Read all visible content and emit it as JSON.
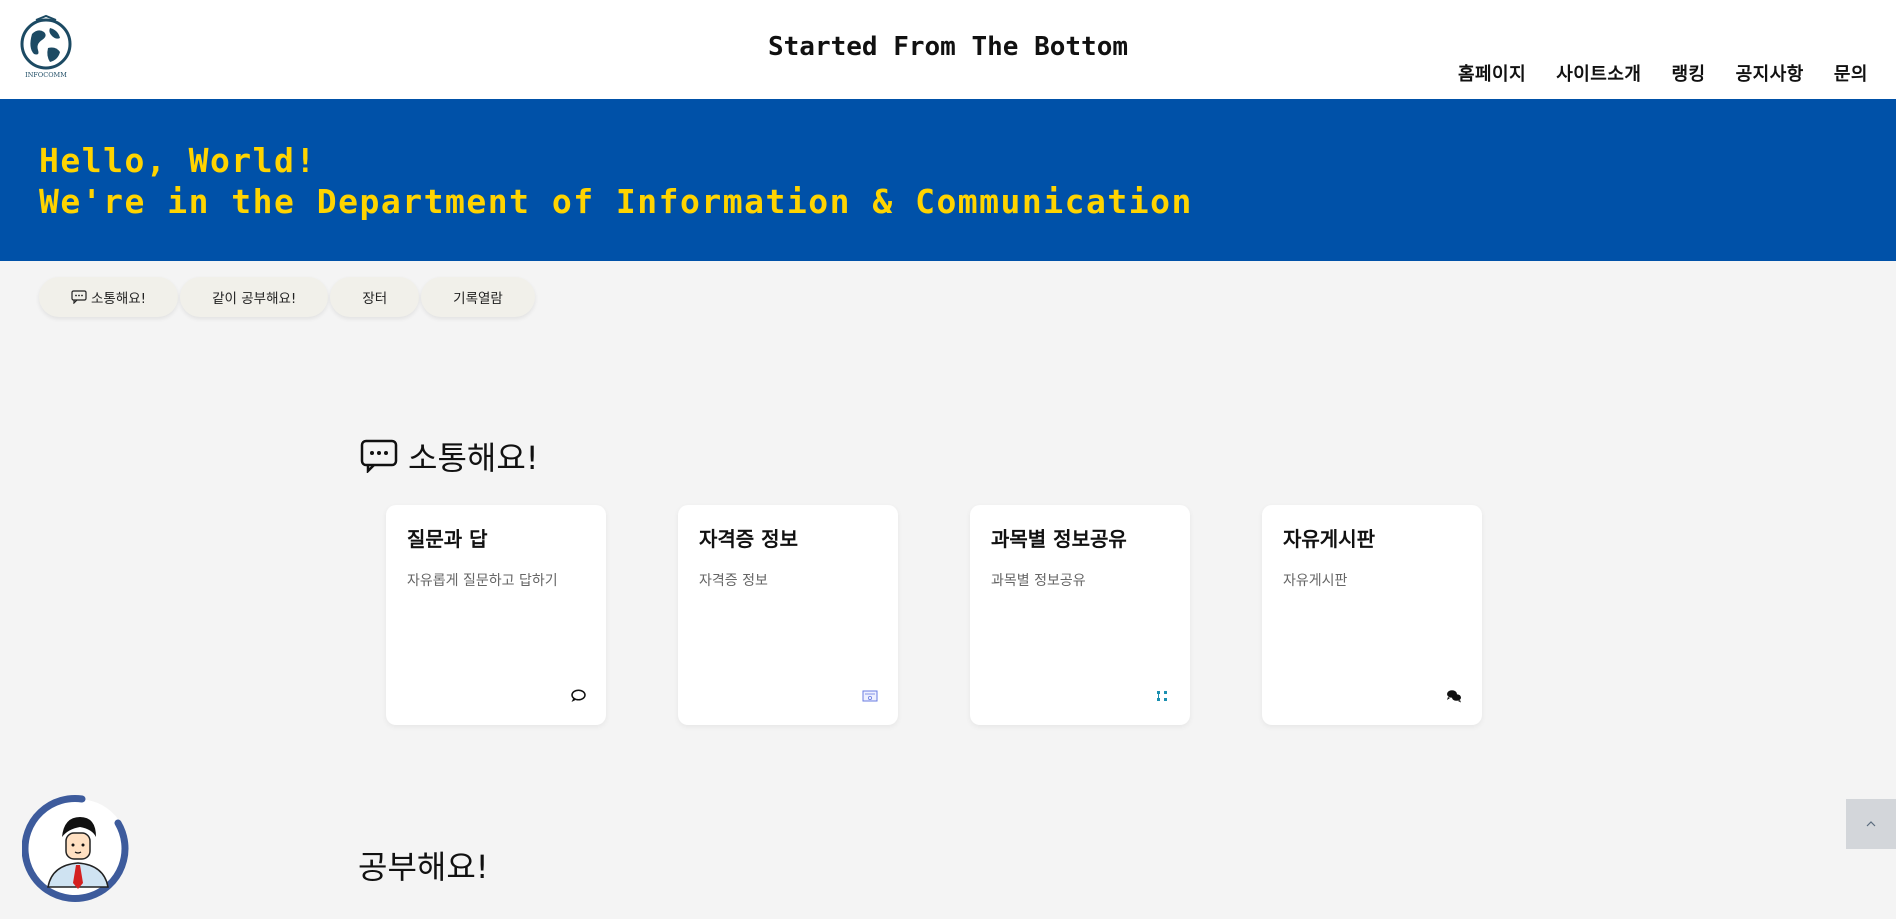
{
  "header": {
    "title": "Started From The Bottom",
    "logo_text": "INFOCOMM",
    "nav": [
      "홈페이지",
      "사이트소개",
      "랭킹",
      "공지사항",
      "문의"
    ]
  },
  "hero": {
    "line1": "Hello, World!",
    "line2": "We're in the Department of Information & Communication"
  },
  "pills": [
    "소통해요!",
    "같이 공부해요!",
    "장터",
    "기록열람"
  ],
  "sections": [
    {
      "title": "소통해요!",
      "cards": [
        {
          "title": "질문과 답",
          "desc": "자유롭게 질문하고 답하기",
          "icon": "comment-icon"
        },
        {
          "title": "자격증 정보",
          "desc": "자격증 정보",
          "icon": "certificate-icon"
        },
        {
          "title": "과목별 정보공유",
          "desc": "과목별 정보공유",
          "icon": "share-nodes-icon"
        },
        {
          "title": "자유게시판",
          "desc": "자유게시판",
          "icon": "comments-icon"
        }
      ]
    },
    {
      "title": "공부해요!"
    }
  ],
  "colors": {
    "hero_bg": "#0051a8",
    "hero_text": "#ffd400",
    "page_bg": "#f4f4f4"
  }
}
